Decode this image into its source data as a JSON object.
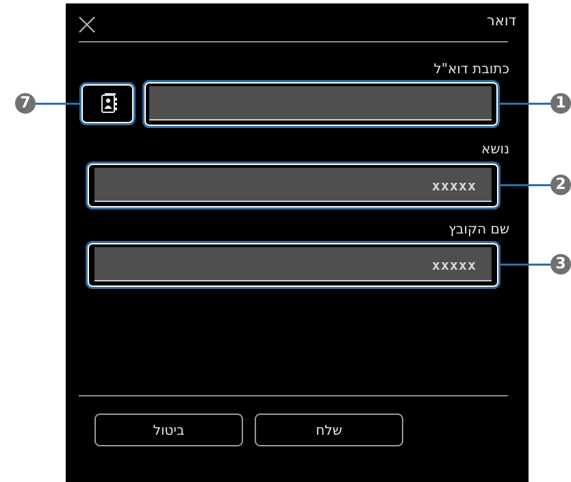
{
  "dialog": {
    "title": "דואר",
    "close_icon": "close-icon"
  },
  "email": {
    "label": "כתובת דוא\"ל",
    "value": "",
    "address_book_icon": "address-book-icon"
  },
  "subject": {
    "label": "נושא",
    "value": "xxxxx"
  },
  "filename": {
    "label": "שם הקובץ",
    "value": "xxxxx"
  },
  "buttons": {
    "send_label": "שלח",
    "cancel_label": "ביטול"
  },
  "callouts": {
    "email_field": "1",
    "subject_field": "2",
    "filename_field": "3",
    "address_book": "7"
  },
  "colors": {
    "panel_bg": "#000000",
    "field_bg": "#4f4f4f",
    "callout_outline": "#2f6fa6",
    "callout_badge": "#707070"
  }
}
